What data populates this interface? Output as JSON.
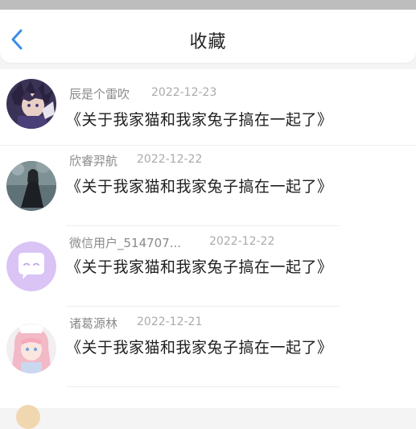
{
  "header": {
    "title": "收藏",
    "accent_color": "#3a8ee6"
  },
  "favorites": [
    {
      "user": "辰是个雷吹",
      "date": "2022-12-23",
      "title": "《关于我家猫和我家兔子搞在一起了》",
      "avatar_icon": "anime-boy-avatar"
    },
    {
      "user": "欣睿羿航",
      "date": "2022-12-22",
      "title": "《关于我家猫和我家兔子搞在一起了》",
      "avatar_icon": "dark-dress-girl-avatar"
    },
    {
      "user": "微信用户_514707...",
      "date": "2022-12-22",
      "title": "《关于我家猫和我家兔子搞在一起了》",
      "avatar_icon": "chat-bubble-avatar"
    },
    {
      "user": "诸葛源林",
      "date": "2022-12-21",
      "title": "《关于我家猫和我家兔子搞在一起了》",
      "avatar_icon": "anime-girl-avatar"
    }
  ]
}
